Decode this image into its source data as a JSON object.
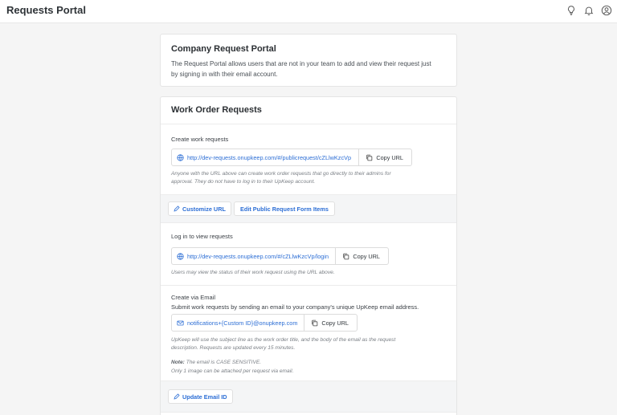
{
  "header": {
    "title": "Requests Portal",
    "icons": [
      "lightbulb-icon",
      "bell-icon",
      "user-icon"
    ]
  },
  "intro": {
    "title": "Company Request Portal",
    "description": "The Request Portal allows users that are not in your team to add and view their request just by signing in with their email account."
  },
  "work_orders": {
    "title": "Work Order Requests",
    "create": {
      "title": "Create work requests",
      "url": "http://dev-requests.onupkeep.com/#/publicrequest/cZLlwKzcVp",
      "copy_label": "Copy URL",
      "hint": "Anyone with the URL above can create work order requests that go directly to their admins for approval. They do not have to log in to their UpKeep account.",
      "customize_label": "Customize URL",
      "edit_form_label": "Edit Public Request Form Items"
    },
    "login": {
      "title": "Log in to view requests",
      "url": "http://dev-requests.onupkeep.com/#/cZLlwKzcVp/login",
      "copy_label": "Copy URL",
      "hint": "Users may view the status of their work request using the URL above."
    },
    "email": {
      "title": "Create via Email",
      "description": "Submit work requests by sending an email to your company's unique UpKeep email address.",
      "address": "notifications+{Custom ID}@onupkeep.com",
      "copy_label": "Copy URL",
      "hint": "UpKeep will use the subject line as the work order title, and the body of the email as the request description. Requests are updated every 15 minutes.",
      "note_label": "Note:",
      "note_text": "The email is CASE SENSITIVE.",
      "note_line2": "Only 1 image can be attached per request via email.",
      "update_label": "Update Email ID"
    }
  }
}
